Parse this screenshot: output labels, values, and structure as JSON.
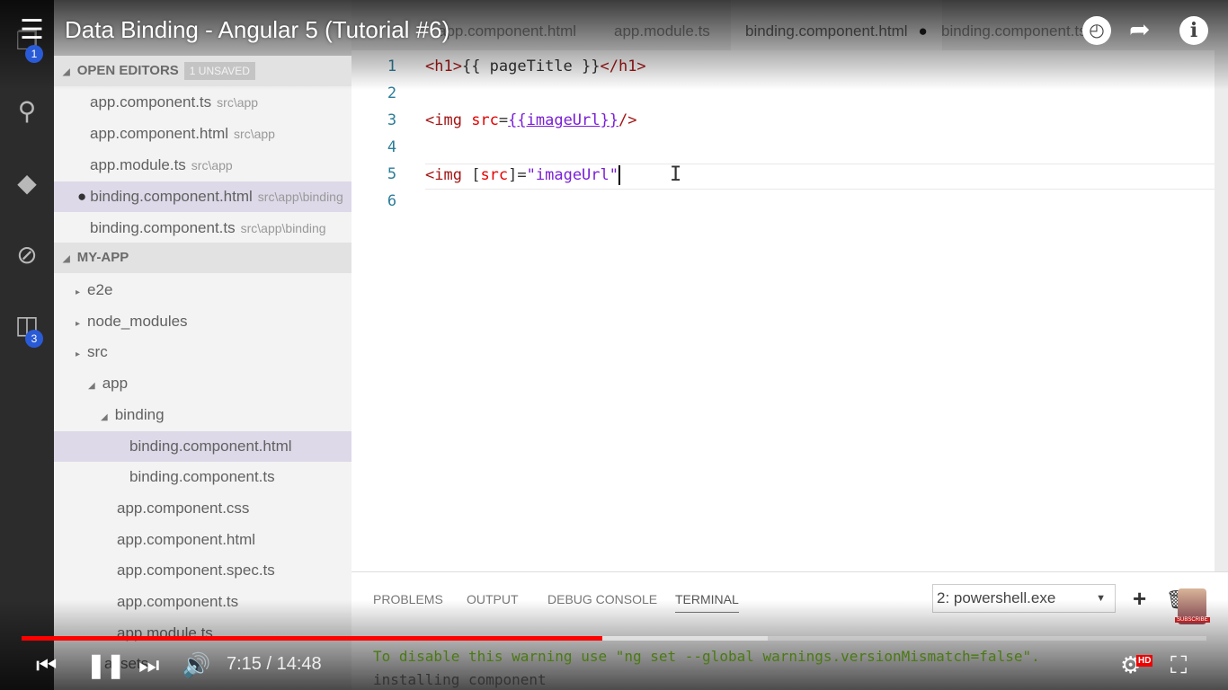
{
  "video": {
    "title": "Data Binding - Angular 5 (Tutorial #6)",
    "current_time": "7:15",
    "duration": "14:48",
    "time_display": "7:15 / 14:48",
    "played_fraction": 0.49,
    "buffered_fraction": 0.63,
    "quality_badge": "HD",
    "subscribe_label": "SUBSCRIBE",
    "accent": "#ff0000"
  },
  "activity_bar": {
    "explorer_badge": "1",
    "extensions_badge": "3"
  },
  "sidebar": {
    "open_editors": {
      "title": "OPEN EDITORS",
      "unsaved": "1 UNSAVED",
      "items": [
        {
          "name": "app.component.ts",
          "path": "src\\app"
        },
        {
          "name": "app.component.html",
          "path": "src\\app"
        },
        {
          "name": "app.module.ts",
          "path": "src\\app"
        },
        {
          "name": "binding.component.html",
          "path": "src\\app\\binding",
          "dirty": "●"
        },
        {
          "name": "binding.component.ts",
          "path": "src\\app\\binding"
        }
      ]
    },
    "project": {
      "title": "MY-APP",
      "tree": [
        {
          "label": "e2e"
        },
        {
          "label": "node_modules"
        },
        {
          "label": "src"
        },
        {
          "label": "app"
        },
        {
          "label": "binding"
        },
        {
          "label": "binding.component.html"
        },
        {
          "label": "binding.component.ts"
        },
        {
          "label": "app.component.css"
        },
        {
          "label": "app.component.html"
        },
        {
          "label": "app.component.spec.ts"
        },
        {
          "label": "app.component.ts"
        },
        {
          "label": "app.module.ts"
        },
        {
          "label": "assets"
        }
      ]
    }
  },
  "tabs": [
    {
      "label": "app.component.html"
    },
    {
      "label": "app.module.ts"
    },
    {
      "label": "binding.component.html",
      "dirty": "●"
    },
    {
      "label": "binding.component.ts"
    }
  ],
  "editor": {
    "lines": [
      {
        "n": "1",
        "tokens": [
          {
            "t": "<h1>",
            "c": "#a31515"
          },
          {
            "t": "{{ pageTitle }}",
            "c": "#333"
          },
          {
            "t": "</h1>",
            "c": "#a31515"
          }
        ]
      },
      {
        "n": "2",
        "tokens": []
      },
      {
        "n": "3",
        "tokens": [
          {
            "t": "<img ",
            "c": "#a31515"
          },
          {
            "t": "src",
            "c": "#e50000"
          },
          {
            "t": "=",
            "c": "#333"
          },
          {
            "t": "{{imageUrl}}",
            "c": "#7a1fd6"
          },
          {
            "t": "/>",
            "c": "#a31515"
          }
        ]
      },
      {
        "n": "4",
        "tokens": []
      },
      {
        "n": "5",
        "tokens": [
          {
            "t": "<img ",
            "c": "#a31515"
          },
          {
            "t": "[",
            "c": "#333"
          },
          {
            "t": "src",
            "c": "#e50000"
          },
          {
            "t": "]=",
            "c": "#333"
          },
          {
            "t": "\"imageUrl\"",
            "c": "#7a1fd6"
          }
        ]
      },
      {
        "n": "6",
        "tokens": []
      }
    ]
  },
  "panel": {
    "tabs": [
      "PROBLEMS",
      "OUTPUT",
      "DEBUG CONSOLE",
      "TERMINAL"
    ],
    "terminal_select": "2: powershell.exe",
    "terminal_lines": [
      "To disable this warning use \"ng set --global warnings.versionMismatch=false\".",
      "installing component"
    ]
  }
}
